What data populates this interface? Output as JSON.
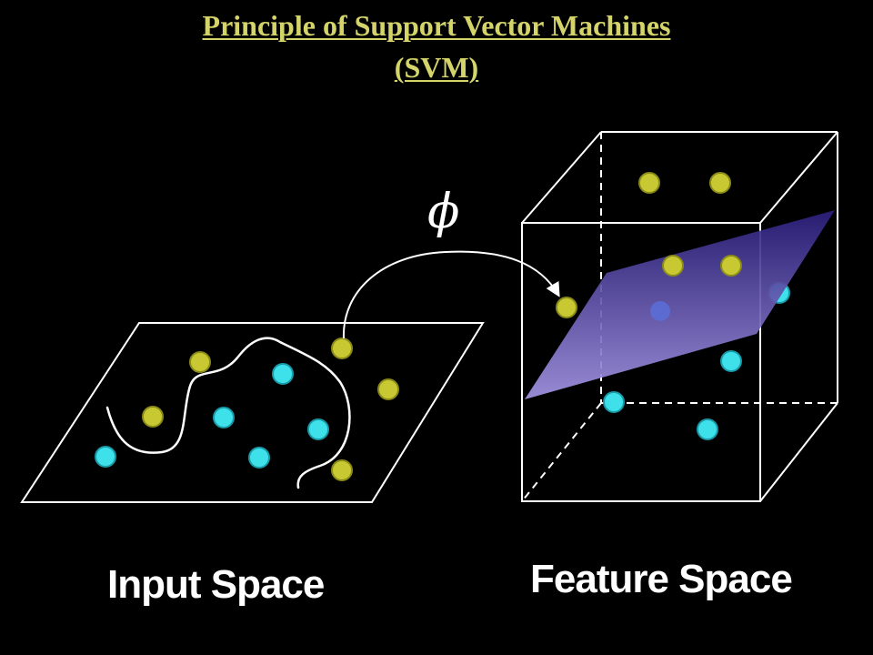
{
  "title": {
    "line1": "Principle of Support Vector Machines",
    "line2": "(SVM)"
  },
  "captions": {
    "input_space": "Input Space",
    "feature_space": "Feature Space"
  },
  "mapping_symbol": "ϕ",
  "colors": {
    "background": "#000000",
    "title": "#d4d46a",
    "caption": "#ffffff",
    "outline": "#ffffff",
    "class_a": "#c8c832",
    "class_a_stroke": "#8a8a1a",
    "class_b": "#3ee0ea",
    "class_b_stroke": "#1a9aa8",
    "hyperplane_top": "#2a1e7a",
    "hyperplane_bottom": "#a596e6"
  },
  "icons": {
    "mapping_arrow": "curved-arrow-icon"
  }
}
